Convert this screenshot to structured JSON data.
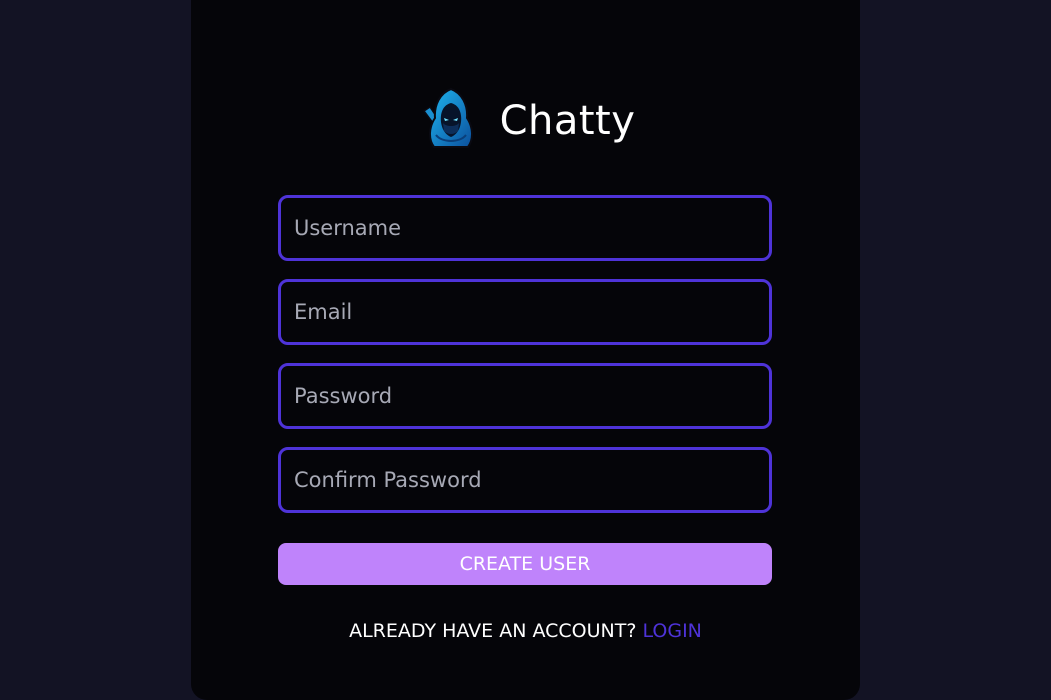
{
  "brand": {
    "name": "Chatty",
    "logo_icon": "hooded-ninja-icon"
  },
  "form": {
    "username_placeholder": "Username",
    "email_placeholder": "Email",
    "password_placeholder": "Password",
    "confirm_password_placeholder": "Confirm Password",
    "submit_label": "CREATE USER"
  },
  "footer": {
    "prompt": "ALREADY HAVE AN ACCOUNT? ",
    "login_label": "LOGIN"
  },
  "colors": {
    "page_background": "#131324",
    "card_background": "#050509",
    "input_border": "#4e33d8",
    "button_background": "#bf83fb",
    "link": "#4e33d8"
  }
}
